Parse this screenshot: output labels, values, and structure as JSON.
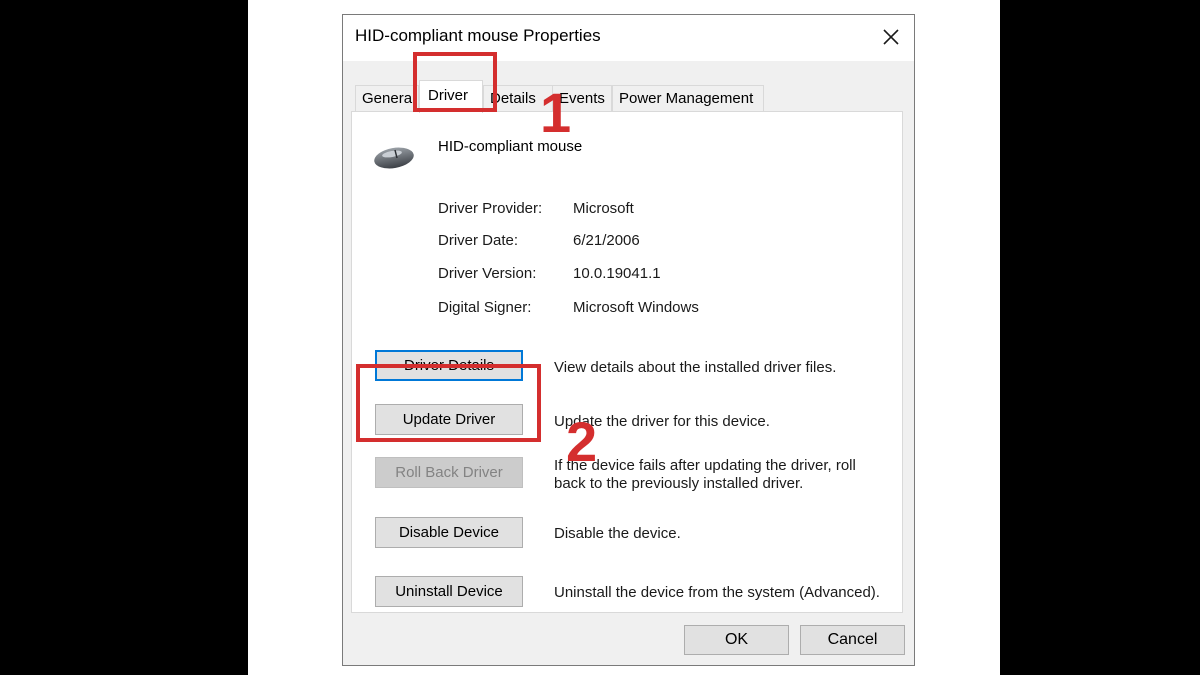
{
  "window": {
    "title": "HID-compliant mouse Properties"
  },
  "tabs": [
    {
      "label": "General"
    },
    {
      "label": "Driver"
    },
    {
      "label": "Details"
    },
    {
      "label": "Events"
    },
    {
      "label": "Power Management"
    }
  ],
  "device": {
    "name": "HID-compliant mouse",
    "icon": "mouse-icon"
  },
  "properties": [
    {
      "label": "Driver Provider:",
      "value": "Microsoft"
    },
    {
      "label": "Driver Date:",
      "value": "6/21/2006"
    },
    {
      "label": "Driver Version:",
      "value": "10.0.19041.1"
    },
    {
      "label": "Digital Signer:",
      "value": "Microsoft Windows"
    }
  ],
  "actions": [
    {
      "button": "Driver Details",
      "description": "View details about the installed driver files."
    },
    {
      "button": "Update Driver",
      "description": "Update the driver for this device."
    },
    {
      "button": "Roll Back Driver",
      "description": "If the device fails after updating the driver, roll back to the previously installed driver."
    },
    {
      "button": "Disable Device",
      "description": "Disable the device."
    },
    {
      "button": "Uninstall Device",
      "description": "Uninstall the device from the system (Advanced)."
    }
  ],
  "footer": {
    "ok": "OK",
    "cancel": "Cancel"
  },
  "annotations": {
    "step1": "1",
    "step2": "2"
  },
  "colors": {
    "highlight": "#d42e2e",
    "focus": "#0078d7"
  }
}
